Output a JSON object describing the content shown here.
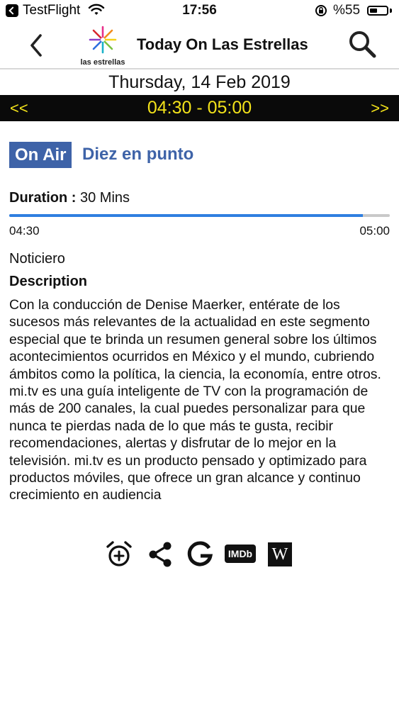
{
  "status_bar": {
    "app_name": "TestFlight",
    "time": "17:56",
    "battery_text": "%55",
    "battery_level": 0.55
  },
  "nav": {
    "logo_text": "las estrellas",
    "title": "Today On Las Estrellas",
    "icons": [
      "back-chevron-icon",
      "search-icon"
    ]
  },
  "schedule": {
    "date": "Thursday, 14 Feb 2019",
    "prev": "<<",
    "range": "04:30 - 05:00",
    "next": ">>"
  },
  "program": {
    "badge": "On Air",
    "title": "Diez en punto",
    "duration_label": "Duration :",
    "duration_value": " 30 Mins",
    "start": "04:30",
    "end": "05:00",
    "progress": 0.93,
    "genre": "Noticiero",
    "description_heading": "Description",
    "description": "Con la conducción de Denise Maerker, entérate de los sucesos más relevantes de la actualidad en este segmento especial que te brinda un resumen general sobre los últimos acontecimientos ocurridos en México y el mundo, cubriendo ámbitos como la política, la ciencia, la economía, entre otros. mi.tv es una guía inteligente de TV con la programación de más de 200 canales, la cual puedes personalizar para que nunca te pierdas nada de lo que más te gusta, recibir recomendaciones, alertas y disfrutar de lo mejor en la televisión. mi.tv es un producto pensado y optimizado para productos móviles, que ofrece un gran alcance y continuo crecimiento en audiencia"
  },
  "actions": {
    "icons": [
      "add-alarm-icon",
      "share-icon",
      "google-icon",
      "imdb-icon",
      "wikipedia-icon"
    ],
    "imdb_text": "IMDb",
    "wiki_text": "W"
  },
  "colors": {
    "accent": "#3e63a8",
    "time_text": "#f2e21a",
    "progress": "#2f7fe0"
  }
}
